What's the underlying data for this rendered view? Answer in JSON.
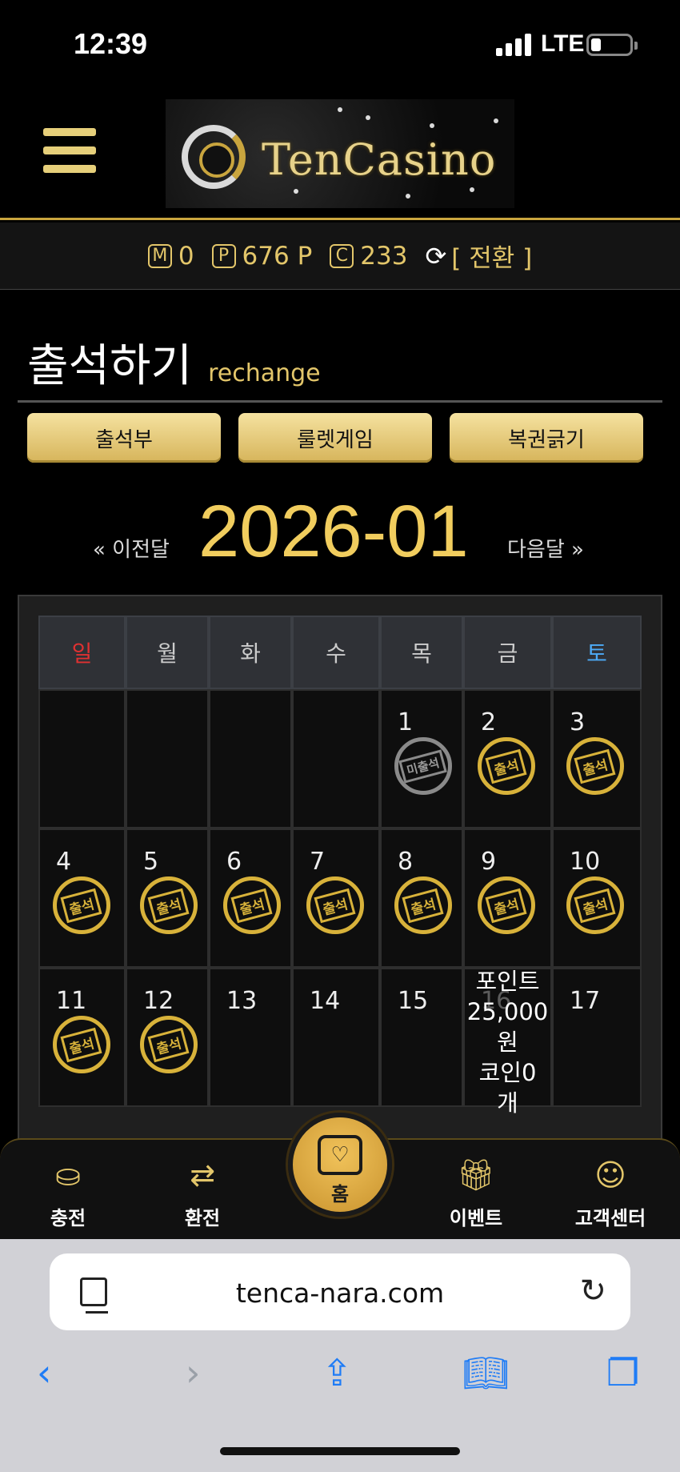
{
  "status_bar": {
    "time": "12:39",
    "network": "LTE"
  },
  "header": {
    "logo_text": "TenCasino"
  },
  "balance": {
    "m_letter": "M",
    "m_value": "0",
    "p_letter": "P",
    "p_value": "676 P",
    "c_letter": "C",
    "c_value": "233",
    "swap_label": "[ 전환 ]"
  },
  "page": {
    "title": "출석하기",
    "subtitle": "rechange"
  },
  "tabs": [
    {
      "label": "출석부"
    },
    {
      "label": "룰렛게임"
    },
    {
      "label": "복권긁기"
    }
  ],
  "month_nav": {
    "prev": "« 이전달",
    "month": "2026-01",
    "next": "다음달 »"
  },
  "calendar": {
    "weekdays": [
      "일",
      "월",
      "화",
      "수",
      "목",
      "금",
      "토"
    ],
    "stamp_attended": "출석",
    "stamp_missed": "미출석",
    "reward_lines": [
      "포인트",
      "25,000",
      "원",
      "코인0",
      "개"
    ],
    "days": [
      {
        "day": "",
        "stamp": ""
      },
      {
        "day": "",
        "stamp": ""
      },
      {
        "day": "",
        "stamp": ""
      },
      {
        "day": "",
        "stamp": ""
      },
      {
        "day": "1",
        "stamp": "missed"
      },
      {
        "day": "2",
        "stamp": "attended"
      },
      {
        "day": "3",
        "stamp": "attended"
      },
      {
        "day": "4",
        "stamp": "attended"
      },
      {
        "day": "5",
        "stamp": "attended"
      },
      {
        "day": "6",
        "stamp": "attended"
      },
      {
        "day": "7",
        "stamp": "attended"
      },
      {
        "day": "8",
        "stamp": "attended"
      },
      {
        "day": "9",
        "stamp": "attended"
      },
      {
        "day": "10",
        "stamp": "attended"
      },
      {
        "day": "11",
        "stamp": "attended"
      },
      {
        "day": "12",
        "stamp": "attended"
      },
      {
        "day": "13",
        "stamp": ""
      },
      {
        "day": "14",
        "stamp": ""
      },
      {
        "day": "15",
        "stamp": ""
      },
      {
        "day": "16",
        "stamp": "reward"
      },
      {
        "day": "17",
        "stamp": ""
      }
    ]
  },
  "bottom_nav": [
    {
      "label": "충전",
      "icon": "charge-icon"
    },
    {
      "label": "환전",
      "icon": "exchange-icon"
    },
    {
      "label": "홈",
      "icon": "home-heart-icon"
    },
    {
      "label": "이벤트",
      "icon": "gift-icon"
    },
    {
      "label": "고객센터",
      "icon": "support-agent-icon"
    }
  ],
  "browser": {
    "url": "tenca-nara.com"
  },
  "colors": {
    "gold": "#e3c66a",
    "sunday": "#e03131",
    "saturday": "#4dabf7",
    "link_blue": "#1f7cf6"
  }
}
